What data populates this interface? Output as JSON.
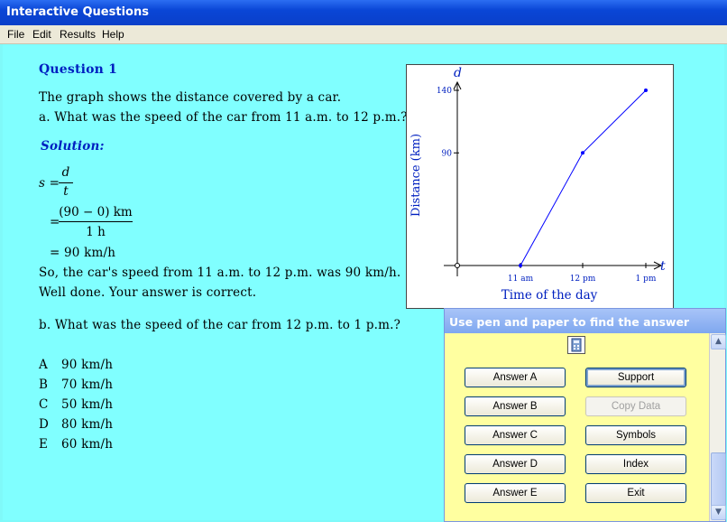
{
  "window": {
    "title": "Interactive Questions"
  },
  "menu": [
    "File",
    "Edit",
    "Results",
    "Help"
  ],
  "question": {
    "heading": "Question 1",
    "intro": "The graph shows the distance covered by a car.",
    "part_a": "a.  What was the speed of the car from 11 a.m. to 12 p.m.?",
    "solution_label": "Solution:",
    "formula_lhs": "s =",
    "formula_num": "d",
    "formula_den": "t",
    "step2_eq": "=",
    "step2_num": "(90 − 0) km",
    "step2_den": "1 h",
    "step3": "= 90 km/h",
    "conclusion": "So, the car's speed from 11 a.m. to 12 p.m. was 90 km/h.",
    "feedback": "Well done.  Your answer is correct.",
    "part_b": "b.  What was the speed of the car from 12 p.m. to 1 p.m.?",
    "options": [
      {
        "letter": "A",
        "text": "90 km/h"
      },
      {
        "letter": "B",
        "text": "70 km/h"
      },
      {
        "letter": "C",
        "text": "50 km/h"
      },
      {
        "letter": "D",
        "text": "80 km/h"
      },
      {
        "letter": "E",
        "text": "60 km/h"
      }
    ]
  },
  "chart_data": {
    "type": "line",
    "x": [
      "11 am",
      "12 pm",
      "1 pm"
    ],
    "y_ticks": [
      90,
      140
    ],
    "ylim": [
      0,
      140
    ],
    "points": [
      {
        "x": "origin",
        "y": 0
      },
      {
        "x": "11 am",
        "y": 0
      },
      {
        "x": "12 pm",
        "y": 90
      },
      {
        "x": "1 pm",
        "y": 140
      }
    ],
    "y_axis_symbol": "d",
    "x_axis_symbol": "t",
    "xlabel": "Time of the day",
    "ylabel": "Distance (km)",
    "line_color": "#0000ff",
    "grid": false
  },
  "panel": {
    "title": "Use pen and paper to find the answer",
    "calculator_icon": "calculator-icon",
    "buttons_left": [
      "Answer A",
      "Answer B",
      "Answer C",
      "Answer D",
      "Answer E"
    ],
    "buttons_right": [
      "Support",
      "Copy Data",
      "Symbols",
      "Index",
      "Exit"
    ]
  }
}
